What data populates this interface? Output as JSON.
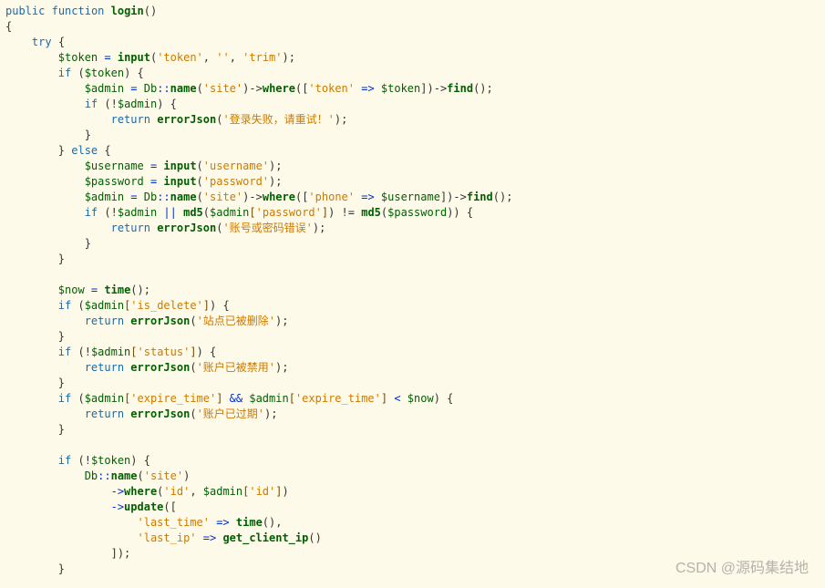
{
  "watermark": "CSDN @源码集结地",
  "code": {
    "l1": {
      "kw1": "public",
      "kw2": "function",
      "fn": "login",
      "p1": "()"
    },
    "l2": {
      "b": "{"
    },
    "l3": {
      "kw": "try",
      "b": " {"
    },
    "l4": {
      "v1": "$token",
      "op1": " = ",
      "fn1": "input",
      "p1": "(",
      "s1": "'token'",
      "c1": ", ",
      "s2": "''",
      "c2": ", ",
      "s3": "'trim'",
      "p2": ");"
    },
    "l5": {
      "kw": "if",
      "p1": " (",
      "v": "$token",
      "p2": ") {"
    },
    "l6": {
      "v1": "$admin",
      "op1": " = ",
      "v2": "Db",
      "op2": "::",
      "fn1": "name",
      "p1": "(",
      "s1": "'site'",
      "p2": ")->",
      "fn2": "where",
      "p3": "([",
      "s2": "'token'",
      "op3": " => ",
      "v3": "$token",
      "p4": "])->",
      "fn3": "find",
      "p5": "();"
    },
    "l7": {
      "kw": "if",
      "p1": " (!",
      "v": "$admin",
      "p2": ") {"
    },
    "l8": {
      "kw": "return",
      "sp": " ",
      "fn": "errorJson",
      "p1": "(",
      "s": "'登录失败，请重试！'",
      "p2": ");"
    },
    "l9": {
      "b": "}"
    },
    "l10": {
      "b1": "} ",
      "kw": "else",
      "b2": " {"
    },
    "l11": {
      "v": "$username",
      "op": " = ",
      "fn": "input",
      "p1": "(",
      "s": "'username'",
      "p2": ");"
    },
    "l12": {
      "v": "$password",
      "op": " = ",
      "fn": "input",
      "p1": "(",
      "s": "'password'",
      "p2": ");"
    },
    "l13": {
      "v1": "$admin",
      "op1": " = ",
      "v2": "Db",
      "op2": "::",
      "fn1": "name",
      "p1": "(",
      "s1": "'site'",
      "p2": ")->",
      "fn2": "where",
      "p3": "([",
      "s2": "'phone'",
      "op3": " => ",
      "v3": "$username",
      "p4": "])->",
      "fn3": "find",
      "p5": "();"
    },
    "l14": {
      "kw": "if",
      "p1": " (!",
      "v1": "$admin",
      "op1": " || ",
      "fn1": "md5",
      "p2": "(",
      "v2": "$admin",
      "br1": "[",
      "s1": "'password'",
      "br2": "]",
      "p3": ") != ",
      "fn2": "md5",
      "p4": "(",
      "v3": "$password",
      "p5": ")) {"
    },
    "l15": {
      "kw": "return",
      "sp": " ",
      "fn": "errorJson",
      "p1": "(",
      "s": "'账号或密码错误'",
      "p2": ");"
    },
    "l16": {
      "b": "}"
    },
    "l17": {
      "b": "}"
    },
    "l18": {
      "v": "$now",
      "op": " = ",
      "fn": "time",
      "p": "();"
    },
    "l19": {
      "kw": "if",
      "p1": " (",
      "v": "$admin",
      "br1": "[",
      "s": "'is_delete'",
      "br2": "]",
      "p2": ") {"
    },
    "l20": {
      "kw": "return",
      "sp": " ",
      "fn": "errorJson",
      "p1": "(",
      "s": "'站点已被删除'",
      "p2": ");"
    },
    "l21": {
      "b": "}"
    },
    "l22": {
      "kw": "if",
      "p1": " (!",
      "v": "$admin",
      "br1": "[",
      "s": "'status'",
      "br2": "]",
      "p2": ") {"
    },
    "l23": {
      "kw": "return",
      "sp": " ",
      "fn": "errorJson",
      "p1": "(",
      "s": "'账户已被禁用'",
      "p2": ");"
    },
    "l24": {
      "b": "}"
    },
    "l25": {
      "kw": "if",
      "p1": " (",
      "v1": "$admin",
      "br1": "[",
      "s1": "'expire_time'",
      "br2": "]",
      "op1": " && ",
      "v2": "$admin",
      "br3": "[",
      "s2": "'expire_time'",
      "br4": "]",
      "op2": " < ",
      "v3": "$now",
      "p2": ") {"
    },
    "l26": {
      "kw": "return",
      "sp": " ",
      "fn": "errorJson",
      "p1": "(",
      "s": "'账户已过期'",
      "p2": ");"
    },
    "l27": {
      "b": "}"
    },
    "l28": {
      "kw": "if",
      "p1": " (!",
      "v": "$token",
      "p2": ") {"
    },
    "l29": {
      "v": "Db",
      "op": "::",
      "fn": "name",
      "p1": "(",
      "s": "'site'",
      "p2": ")"
    },
    "l30": {
      "arrow": "->",
      "fn": "where",
      "p1": "(",
      "s": "'id'",
      "c": ", ",
      "v": "$admin",
      "br1": "[",
      "s2": "'id'",
      "br2": "]",
      "p2": ")"
    },
    "l31": {
      "arrow": "->",
      "fn": "update",
      "p": "(["
    },
    "l32": {
      "s": "'last_time'",
      "op": " => ",
      "fn": "time",
      "p": "(),"
    },
    "l33": {
      "s": "'last_ip'",
      "op": " => ",
      "fn": "get_client_ip",
      "p": "()"
    },
    "l34": {
      "p": "]);"
    },
    "l35": {
      "b": "}"
    }
  }
}
